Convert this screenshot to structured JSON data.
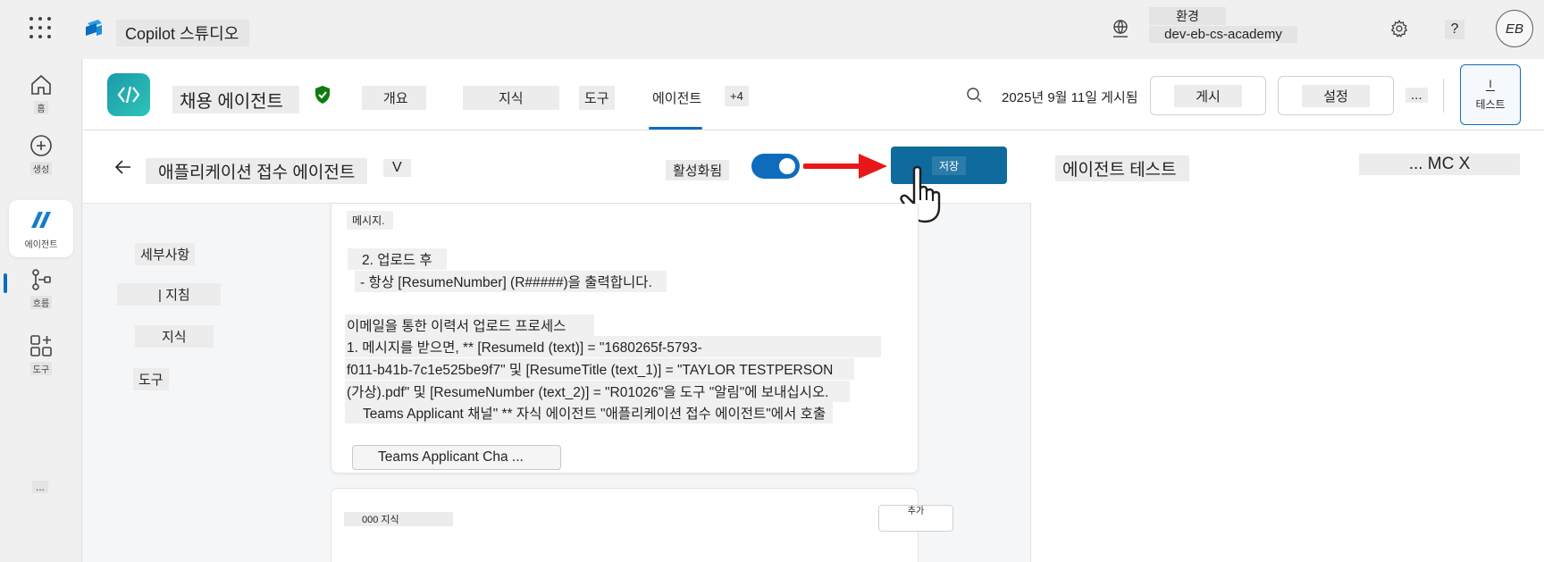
{
  "topbar": {
    "app_title": "Copilot 스튜디오",
    "env_label": "환경",
    "env_value": "dev-eb-cs-academy",
    "help": "?",
    "avatar_initials": "EB"
  },
  "nav": {
    "items": [
      {
        "label": "홈",
        "icon": "home-icon"
      },
      {
        "label": "생성",
        "icon": "plus-circle-icon"
      },
      {
        "label": "에이전트",
        "icon": "agent-icon"
      },
      {
        "label": "흐름",
        "icon": "flow-icon"
      },
      {
        "label": "도구",
        "icon": "tools-icon"
      }
    ],
    "more": "..."
  },
  "agent_header": {
    "name": "채용 에이전트",
    "tabs": [
      "개요",
      "지식",
      "도구",
      "에이전트",
      "+4"
    ],
    "active_tab": "에이전트",
    "published": "2025년 9월 11일 게시됨",
    "publish_btn": "게시",
    "settings_btn": "설정",
    "more": "...",
    "test_btn": "테스트",
    "test_icon_text": "I"
  },
  "subbar": {
    "title": "애플리케이션 접수 에이전트",
    "version": "V",
    "active_label": "활성화됨",
    "save": "저장"
  },
  "toc": {
    "details": "세부사항",
    "instructions": "| 지침",
    "knowledge": "지식",
    "tools": "도구"
  },
  "content": {
    "msg_label": "메시지.",
    "step2": "2. 업로드 후",
    "step2_detail": "- 항상 [ResumeNumber] (R#####)을 출력합니다.",
    "email_heading": "이메일을 통한 이력서 업로드 프로세스",
    "line1": "1. 메시지를 받으면, ** [ResumeId (text)] = \"1680265f-5793-",
    "line2": "f011-b41b-7c1e525be9f7\" 및 [ResumeTitle (text_1)] = \"TAYLOR TESTPERSON",
    "line3": "(가상).pdf\" 및 [ResumeNumber (text_2)] = \"R01026\"을 도구 \"알림\"에 보내십시오.",
    "line4": "Teams Applicant 채널\" ** 자식 에이전트 \"애플리케이션 접수 에이전트\"에서 호출",
    "chip": "Teams Applicant Cha ...",
    "knowledge_card_title": "000 지식",
    "knowledge_card_btn": "추가"
  },
  "test_panel": {
    "title": "에이전트 테스트",
    "right_text": "... MC X"
  },
  "colors": {
    "accent": "#0f6cbd",
    "save_button": "#0f6a9e",
    "arrow": "#e81818"
  }
}
